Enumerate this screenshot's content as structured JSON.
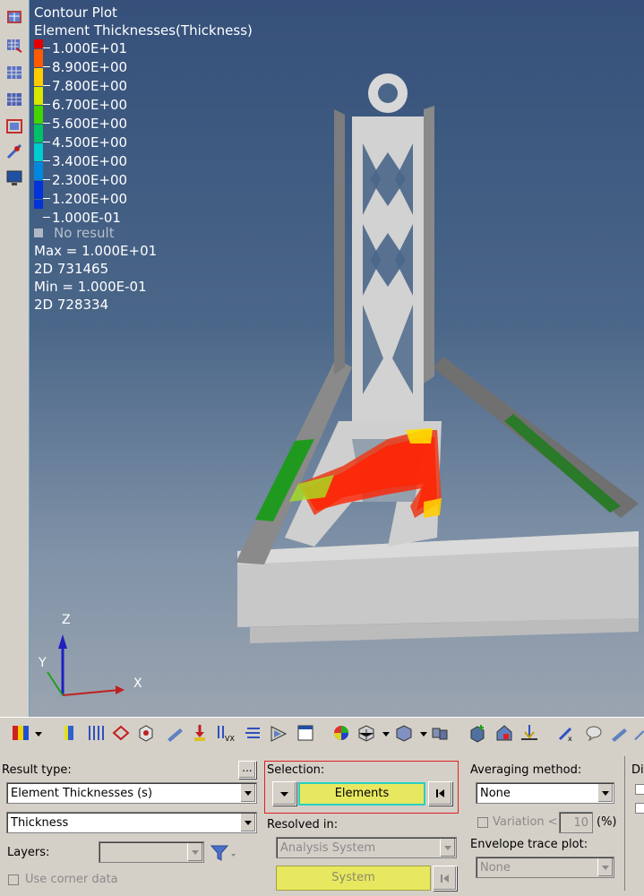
{
  "legend": {
    "title": "Contour Plot",
    "subtitle": "Element Thicknesses(Thickness)",
    "entries": [
      {
        "label": "1.000E+01",
        "color": "#e20000"
      },
      {
        "label": "8.900E+00",
        "color": "#ff5a00"
      },
      {
        "label": "7.800E+00",
        "color": "#ffcc00"
      },
      {
        "label": "6.700E+00",
        "color": "#d8e600"
      },
      {
        "label": "5.600E+00",
        "color": "#44d400"
      },
      {
        "label": "4.500E+00",
        "color": "#00c068"
      },
      {
        "label": "3.400E+00",
        "color": "#00cdd0"
      },
      {
        "label": "2.300E+00",
        "color": "#0088e0"
      },
      {
        "label": "1.200E+00",
        "color": "#0033d8"
      },
      {
        "label": "1.000E-01",
        "color": ""
      }
    ],
    "no_result": "No result",
    "max_label": "Max = 1.000E+01",
    "max_id": "2D 731465",
    "min_label": "Min = 1.000E-01",
    "min_id": "2D 728334"
  },
  "triad": {
    "z": "Z",
    "y": "Y",
    "x": "X"
  },
  "panel": {
    "result_type_label": "Result type:",
    "more_button": "...",
    "result_type_value": "Element Thicknesses (s)",
    "component_value": "Thickness",
    "layers_label": "Layers:",
    "layers_value": "",
    "use_corner_label": "Use corner data",
    "selection_label": "Selection:",
    "selection_value": "Elements",
    "resolved_label": "Resolved in:",
    "resolved_value": "Analysis System",
    "system_value": "System",
    "averaging_label": "Averaging method:",
    "averaging_value": "None",
    "variation_label": "Variation <",
    "variation_value": "10",
    "variation_unit": "(%)",
    "envelope_label": "Envelope trace plot:",
    "envelope_value": "None",
    "display_label": "Di"
  },
  "colors": {
    "accent_selection": "#e8e860",
    "selection_border": "#e02020",
    "viewport_top": "#35507a",
    "viewport_bottom": "#9aa4b0"
  }
}
